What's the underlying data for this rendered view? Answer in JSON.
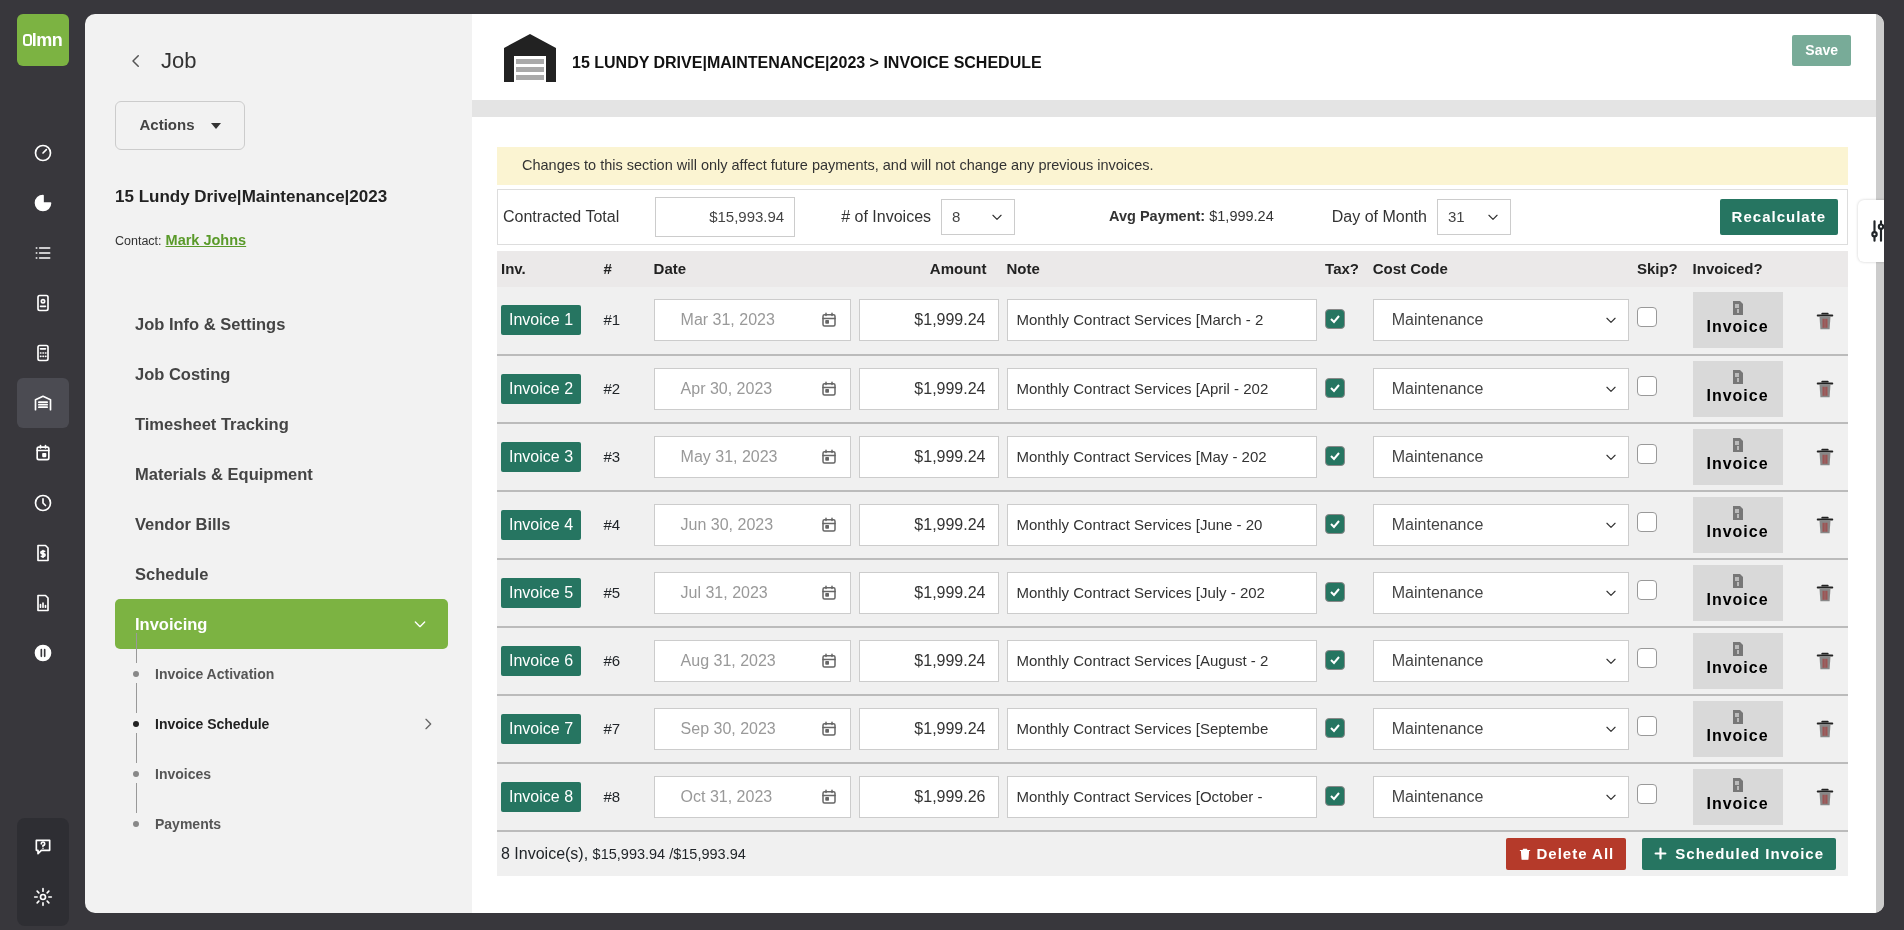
{
  "logo": "lmn",
  "rail": [
    {
      "selected": false
    },
    {
      "selected": false
    },
    {
      "selected": false
    },
    {
      "selected": false
    },
    {
      "selected": false
    },
    {
      "selected": true
    },
    {
      "selected": false
    },
    {
      "selected": false
    },
    {
      "selected": false
    },
    {
      "selected": false
    },
    {
      "selected": false
    }
  ],
  "sidebar": {
    "title": "Job",
    "actions": "Actions",
    "job_name": "15 Lundy Drive|Maintenance|2023",
    "contact_label": "Contact:",
    "contact": "Mark Johns",
    "items": [
      {
        "label": "Job Info & Settings",
        "selected": false
      },
      {
        "label": "Job Costing",
        "selected": false
      },
      {
        "label": "Timesheet Tracking",
        "selected": false
      },
      {
        "label": "Materials & Equipment",
        "selected": false
      },
      {
        "label": "Vendor Bills",
        "selected": false
      },
      {
        "label": "Schedule",
        "selected": false
      },
      {
        "label": "Invoicing",
        "selected": true,
        "expanded": true,
        "children": [
          {
            "label": "Invoice Activation",
            "selected": false
          },
          {
            "label": "Invoice Schedule",
            "selected": true
          },
          {
            "label": "Invoices",
            "selected": false
          },
          {
            "label": "Payments",
            "selected": false
          }
        ]
      }
    ]
  },
  "header": {
    "title": "15 LUNDY DRIVE|MAINTENANCE|2023 > INVOICE SCHEDULE",
    "save": "Save"
  },
  "notice": "Changes to this section will only affect future payments, and will not change any previous invoices.",
  "controls": {
    "contracted_total_label": "Contracted Total",
    "contracted_total": "$15,993.94",
    "invoices_label": "# of Invoices",
    "invoices": "8",
    "avg_label": "Avg Payment:",
    "avg": "$1,999.24",
    "day_label": "Day of Month",
    "day": "31",
    "recalculate": "Recalculate"
  },
  "table": {
    "columns": [
      "Inv.",
      "#",
      "Date",
      "Amount",
      "Note",
      "Tax?",
      "Cost Code",
      "Skip?",
      "Invoiced?"
    ],
    "rows": [
      {
        "inv": "Invoice 1",
        "num": "#1",
        "date": "Mar 31, 2023",
        "amount": "$1,999.24",
        "note": "Monthly Contract Services [March - 2",
        "tax": true,
        "cost_code": "Maintenance",
        "skip": false,
        "invoiced": "Invoice"
      },
      {
        "inv": "Invoice 2",
        "num": "#2",
        "date": "Apr 30, 2023",
        "amount": "$1,999.24",
        "note": "Monthly Contract Services [April - 202",
        "tax": true,
        "cost_code": "Maintenance",
        "skip": false,
        "invoiced": "Invoice"
      },
      {
        "inv": "Invoice 3",
        "num": "#3",
        "date": "May 31, 2023",
        "amount": "$1,999.24",
        "note": "Monthly Contract Services [May - 202",
        "tax": true,
        "cost_code": "Maintenance",
        "skip": false,
        "invoiced": "Invoice"
      },
      {
        "inv": "Invoice 4",
        "num": "#4",
        "date": "Jun 30, 2023",
        "amount": "$1,999.24",
        "note": "Monthly Contract Services [June - 20",
        "tax": true,
        "cost_code": "Maintenance",
        "skip": false,
        "invoiced": "Invoice"
      },
      {
        "inv": "Invoice 5",
        "num": "#5",
        "date": "Jul 31, 2023",
        "amount": "$1,999.24",
        "note": "Monthly Contract Services [July - 202",
        "tax": true,
        "cost_code": "Maintenance",
        "skip": false,
        "invoiced": "Invoice"
      },
      {
        "inv": "Invoice 6",
        "num": "#6",
        "date": "Aug 31, 2023",
        "amount": "$1,999.24",
        "note": "Monthly Contract Services [August - 2",
        "tax": true,
        "cost_code": "Maintenance",
        "skip": false,
        "invoiced": "Invoice"
      },
      {
        "inv": "Invoice 7",
        "num": "#7",
        "date": "Sep 30, 2023",
        "amount": "$1,999.24",
        "note": "Monthly Contract Services [Septembe",
        "tax": true,
        "cost_code": "Maintenance",
        "skip": false,
        "invoiced": "Invoice"
      },
      {
        "inv": "Invoice 8",
        "num": "#8",
        "date": "Oct 31, 2023",
        "amount": "$1,999.26",
        "note": "Monthly Contract Services [October -",
        "tax": true,
        "cost_code": "Maintenance",
        "skip": false,
        "invoiced": "Invoice"
      }
    ],
    "footer": {
      "count": "8 Invoice(s),",
      "totals": "$15,993.94 /$15,993.94",
      "delete_all": "Delete All",
      "add": "Scheduled Invoice"
    }
  }
}
